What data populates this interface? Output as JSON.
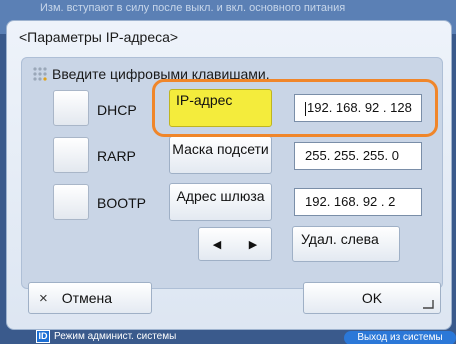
{
  "background_notice": "Изм. вступают в силу после выкл. и вкл. основного питания",
  "dialog": {
    "title": "<Параметры IP-адреса>",
    "instruction": "Введите цифровыми клавишами.",
    "methods": [
      {
        "label": "DHCP",
        "checked": false
      },
      {
        "label": "RARP",
        "checked": false
      },
      {
        "label": "BOOTP",
        "checked": false
      }
    ],
    "fields": {
      "ip_label": "IP-адрес",
      "ip_value": "192. 168. 92  . 128",
      "mask_label": "Маска подсети",
      "mask_value": "255. 255. 255. 0",
      "gateway_label": "Адрес шлюза",
      "gateway_value": "192. 168. 92  . 2"
    },
    "nav": {
      "left": "◀",
      "right": "▶"
    },
    "backspace_label": "Удал. слева",
    "cancel_label": "Отмена",
    "ok_label": "OK"
  },
  "status_bar": {
    "mode_icon": "ID",
    "mode_label": "Режим админист. системы",
    "logout_label": "Выход из системы"
  },
  "colors": {
    "active_field": "#f4ec3c",
    "highlight": "#f0862a",
    "logout": "#2b78d8"
  }
}
